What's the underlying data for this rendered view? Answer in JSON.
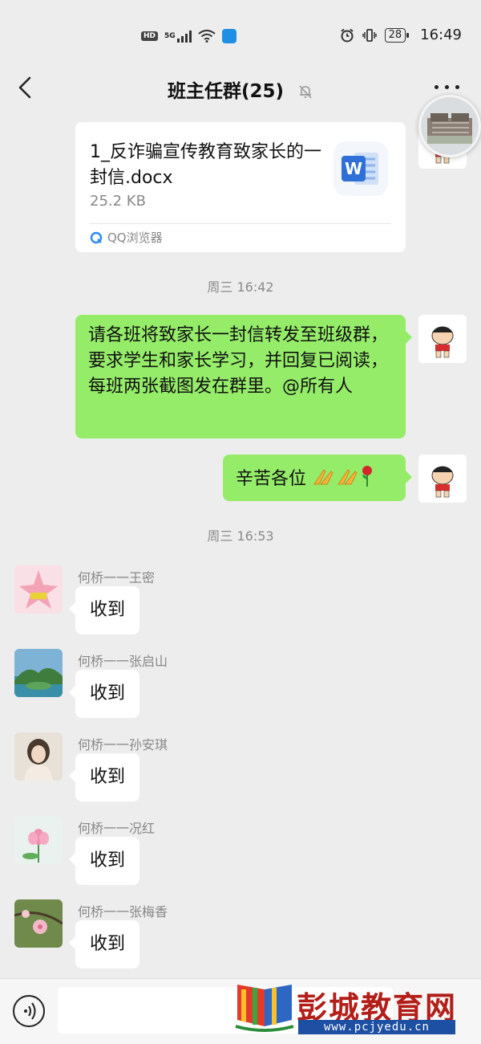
{
  "status_bar": {
    "network_hd": "HD",
    "network_gen": "5G",
    "battery": "28",
    "time": "16:49"
  },
  "header": {
    "title": "班主任群(25)"
  },
  "file_message": {
    "file_name": "1_反诈骗宣传教育致家长的一封信.docx",
    "file_size": "25.2 KB",
    "source_app": "QQ浏览器"
  },
  "timestamps": [
    "周三 16:42",
    "周三 16:53"
  ],
  "sent_messages": [
    {
      "text": "请各班将致家长一封信转发至班级群，要求学生和家长学习，并回复已阅读，每班两张截图发在群里。@所有人"
    },
    {
      "text": "辛苦各位"
    }
  ],
  "received_messages": [
    {
      "sender": "何桥一一王密",
      "text": "收到",
      "avatar": "patrick-star-avatar"
    },
    {
      "sender": "何桥一一张启山",
      "text": "收到",
      "avatar": "landscape-avatar"
    },
    {
      "sender": "何桥一一孙安琪",
      "text": "收到",
      "avatar": "portrait-avatar"
    },
    {
      "sender": "何桥一一况红",
      "text": "收到",
      "avatar": "lotus-avatar"
    },
    {
      "sender": "何桥一一张梅香",
      "text": "收到",
      "avatar": "peach-blossom-avatar"
    }
  ],
  "watermark": {
    "name": "彭城教育网",
    "url": "www.pcjyedu.cn"
  },
  "colors": {
    "background": "#ededed",
    "sent_bubble": "#95ec69",
    "received_bubble": "#ffffff",
    "watermark_red": "#b31e18",
    "watermark_blue": "#1d4fa3"
  }
}
